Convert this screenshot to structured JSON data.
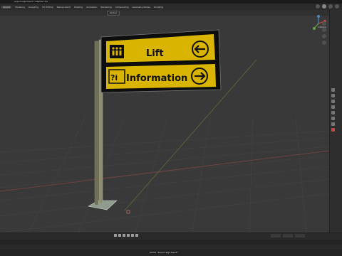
{
  "window": {
    "title": "airport-sign.blend - Blender 4.0"
  },
  "menubar": {
    "items": [
      "Layout",
      "Modeling",
      "Sculpting",
      "UV Editing",
      "Texture Paint",
      "Shading",
      "Animation",
      "Rendering",
      "Compositing",
      "Geometry Nodes",
      "Scripting"
    ],
    "active_index": 0
  },
  "viewport": {
    "mode": "Global",
    "options_label": "Options",
    "sign": {
      "top_label": "Lift",
      "bottom_label": "Information",
      "bottom_icon": "?i",
      "top_arrow": "arrow-left",
      "bottom_arrow": "arrow-right",
      "panel_color": "#d9b400",
      "frame_color": "#0d0d0d"
    }
  },
  "statusbar": {
    "notice": "Saved \"airport-sign.blend\""
  },
  "colors": {
    "viewport_bg": "#393939",
    "grid_line": "#444444",
    "x_axis": "#8a4b4b",
    "y_axis": "#6b7b3b",
    "pole": "#8d8d6e",
    "base": "#8f9b8f"
  }
}
